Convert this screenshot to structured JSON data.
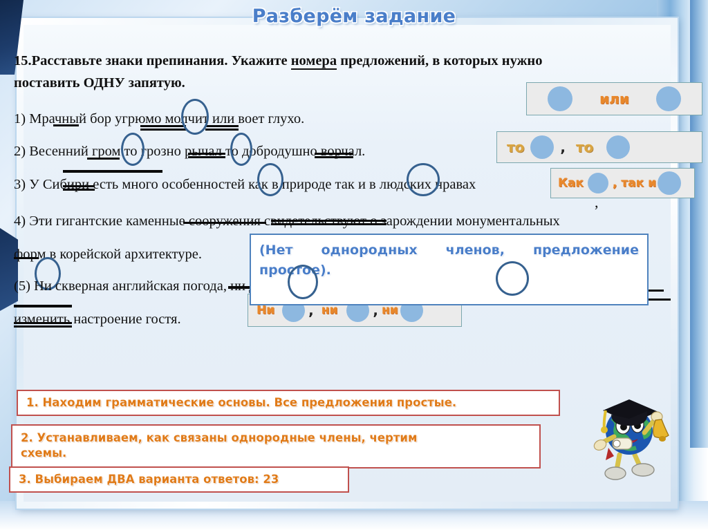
{
  "slide": {
    "title": "Разберём задание"
  },
  "task": {
    "number": "15.",
    "line1_a": "Расставьте знаки препинания. Укажите ",
    "line1_underlined": "номера",
    "line1_b": " предложений, в которых нужно",
    "line2": "поставить ОДНУ запятую."
  },
  "sentences": [
    {
      "id": "s1",
      "text": "1) Мрачный бор угрюмо молчит или воет глухо."
    },
    {
      "id": "s2",
      "text": "2)  Весенний гром то грозно рычал то добродушно ворчал."
    },
    {
      "id": "s3",
      "text": "3) У Сибири  есть много особенностей как в природе так и в людских нравах"
    },
    {
      "id": "s4a",
      "text": "4) Эти гигантские каменные сооружения свидетельствуют о зарождении монументальных"
    },
    {
      "id": "s4b",
      "text": "форм в корейской архитектуре."
    },
    {
      "id": "s5a",
      "text": "(5) Ни скверная английская погода, ни дожди, ни туманы не могли"
    },
    {
      "id": "s5b",
      "text": "изменить настроение гостя."
    }
  ],
  "schemes": [
    {
      "name": "or-scheme",
      "parts": [
        {
          "type": "dot"
        },
        {
          "type": "word",
          "text": "или",
          "style": "orange"
        },
        {
          "type": "dot"
        }
      ]
    },
    {
      "name": "to-to-scheme",
      "parts": [
        {
          "type": "word",
          "text": "то",
          "style": "gold"
        },
        {
          "type": "dot"
        },
        {
          "type": "comma",
          "text": ","
        },
        {
          "type": "word",
          "text": "то",
          "style": "gold"
        },
        {
          "type": "dot"
        }
      ]
    },
    {
      "name": "kak-tak-i-scheme",
      "parts": [
        {
          "type": "word",
          "text": "Как",
          "style": "orange"
        },
        {
          "type": "dot"
        },
        {
          "type": "word",
          "text": ", так и",
          "style": "orange"
        },
        {
          "type": "dot"
        }
      ]
    },
    {
      "name": "ni-ni-ni-scheme",
      "parts": [
        {
          "type": "word",
          "text": "Ни",
          "style": "orange"
        },
        {
          "type": "dot"
        },
        {
          "type": "comma",
          "text": ","
        },
        {
          "type": "word",
          "text": "ни",
          "style": "orange"
        },
        {
          "type": "dot"
        },
        {
          "type": "comma",
          "text": ","
        },
        {
          "type": "word",
          "text": "ни",
          "style": "orange"
        },
        {
          "type": "dot"
        }
      ]
    }
  ],
  "explanation": {
    "text": "(Нет однородных членов, предложение простое)."
  },
  "steps": [
    {
      "id": "step1",
      "text": "1. Находим грамматические основы. Все предложения простые."
    },
    {
      "id": "step2",
      "text": "2. Устанавливаем, как связаны однородные члены, чертим\nсхемы."
    },
    {
      "id": "step3",
      "text": "3. Выбираем ДВА варианта ответов: 23"
    }
  ],
  "colors": {
    "title_blue": "#4a7ec9",
    "scheme_orange": "#e8872a",
    "scheme_gold": "#d9a441",
    "callout_border": "#c0504d",
    "callout_text": "#e07b19",
    "circle_blue": "#36618f",
    "dot_blue": "#8db8e0"
  }
}
